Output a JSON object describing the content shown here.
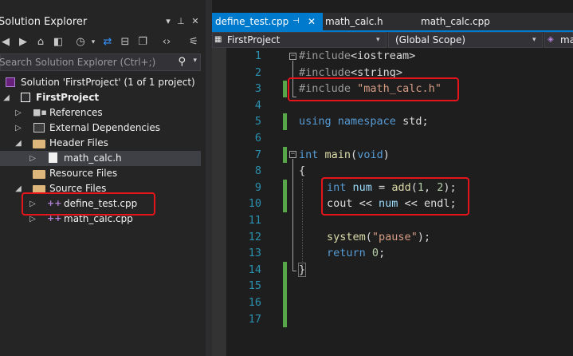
{
  "solution_explorer": {
    "title": "Solution Explorer",
    "search_placeholder": "Search Solution Explorer (Ctrl+;)",
    "tree": {
      "solution": "Solution 'FirstProject' (1 of 1 project)",
      "project": "FirstProject",
      "references": "References",
      "external_deps": "External Dependencies",
      "header_files": "Header Files",
      "header_file_1": "math_calc.h",
      "resource_files": "Resource Files",
      "source_files": "Source Files",
      "source_file_1": "define_test.cpp",
      "source_file_2": "math_calc.cpp"
    }
  },
  "tabs": {
    "active": "define_test.cpp",
    "tab2": "math_calc.h",
    "tab3": "math_calc.cpp"
  },
  "navbar": {
    "project": "FirstProject",
    "scope": "(Global Scope)",
    "member": "ma"
  },
  "editor": {
    "line_numbers": [
      "1",
      "2",
      "3",
      "4",
      "5",
      "6",
      "7",
      "8",
      "9",
      "10",
      "11",
      "12",
      "13",
      "14",
      "15",
      "16",
      "17"
    ],
    "code": {
      "l1_pp": "#include",
      "l1_arg": "<iostream>",
      "l2_pp": "#include",
      "l2_arg": "<string>",
      "l3_pp": "#include",
      "l3_arg": "\"math_calc.h\"",
      "l5_kw1": "using",
      "l5_kw2": "namespace",
      "l5_id": "std;",
      "l7_kw": "int",
      "l7_fn": "main",
      "l7_open": "(",
      "l7_void": "void",
      "l7_close": ")",
      "l8": "{",
      "l9_kw": "int",
      "l9_var": "num",
      "l9_eq": " = ",
      "l9_fn": "add",
      "l9_p1": "(",
      "l9_n1": "1",
      "l9_comma": ", ",
      "l9_n2": "2",
      "l9_p2": ");",
      "l10_cout": "cout",
      "l10_op1": " << ",
      "l10_var": "num",
      "l10_op2": " << ",
      "l10_endl": "endl;",
      "l12_fn": "system",
      "l12_p1": "(",
      "l12_str": "\"pause\"",
      "l12_p2": ");",
      "l13_kw": "return",
      "l13_num": "0",
      "l13_end": ";",
      "l14": "}"
    }
  }
}
